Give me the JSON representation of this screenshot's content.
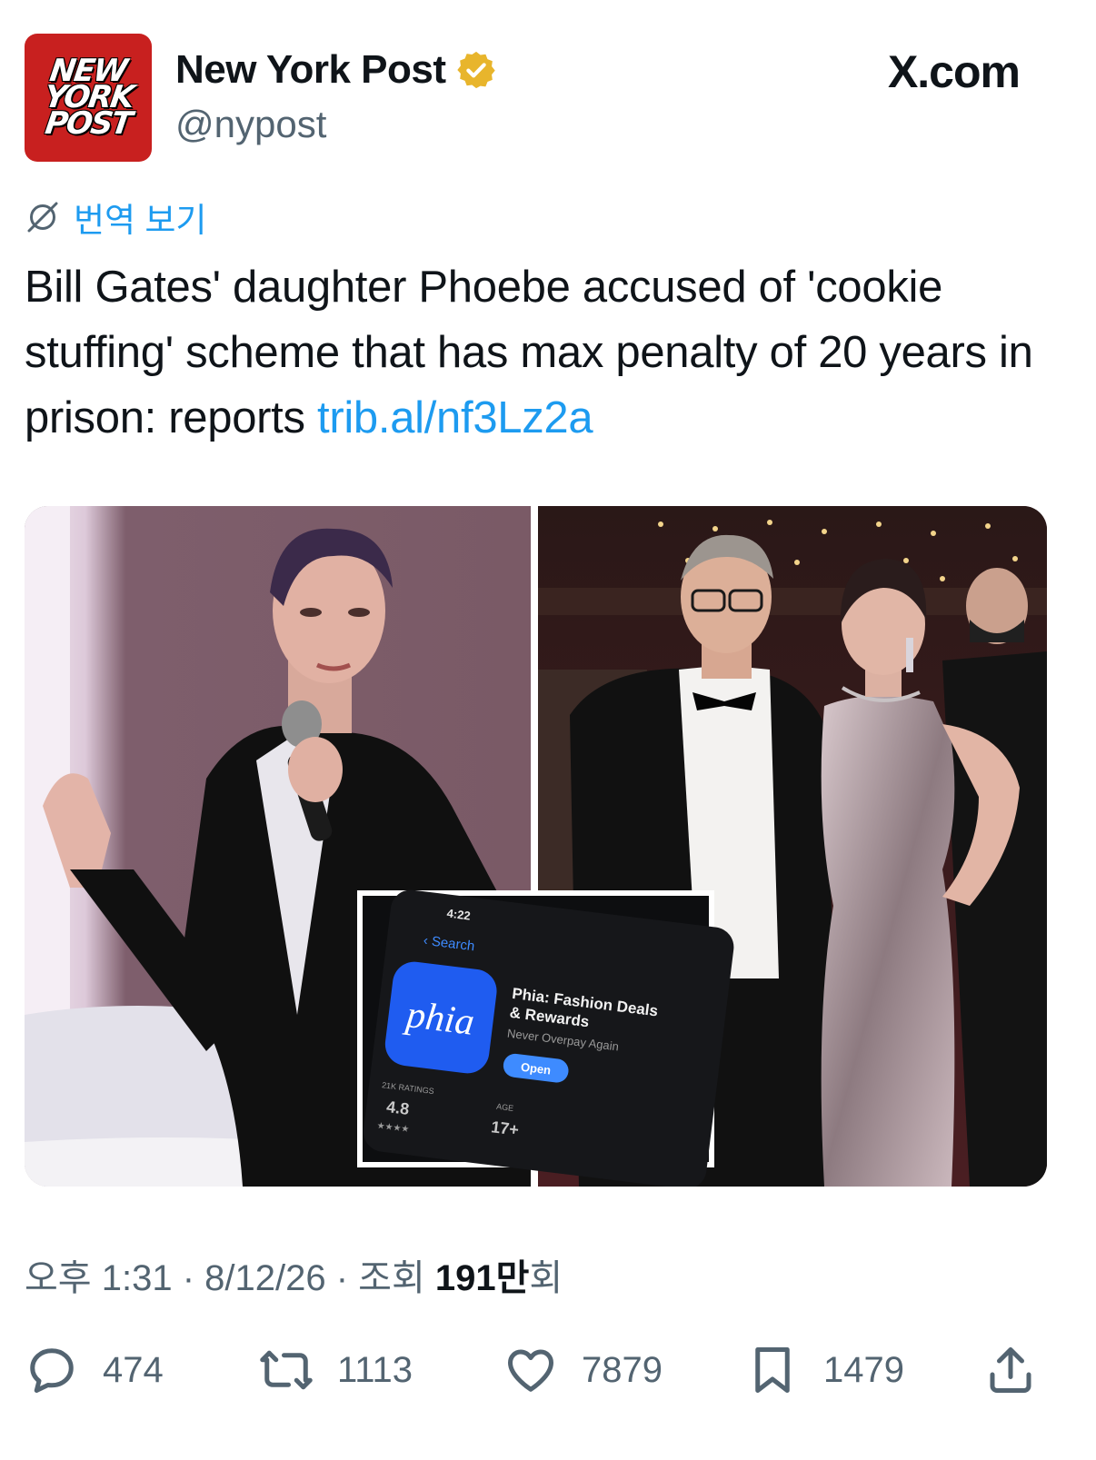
{
  "account": {
    "logo_lines": [
      "NEW",
      "YORK",
      "POST"
    ],
    "name": "New York Post",
    "handle": "@nypost",
    "verified": true,
    "verified_color": "#e8b52c"
  },
  "site_label": "X.com",
  "translate_label": "번역 보기",
  "tweet": {
    "text": "Bill Gates' daughter Phoebe accused of 'cookie stuffing' scheme that has max penalty of 20 years in prison: reports ",
    "link": "trib.al/nf3Lz2a"
  },
  "media": {
    "description_icon": "photo-collage",
    "inset": {
      "status_time": "4:22",
      "back_label": "Search",
      "app_icon_text": "phia",
      "app_title_line1": "Phia: Fashion Deals",
      "app_title_line2": "& Rewards",
      "app_subtitle": "Never Overpay Again",
      "open_button": "Open",
      "ratings_label": "21K RATINGS",
      "rating_value": "4.8",
      "age_label": "AGE",
      "age_value": "17+"
    }
  },
  "meta": {
    "time": "오후 1:31",
    "sep1": " · ",
    "date": "8/12/26",
    "sep2": " · ",
    "views_label": "조회 ",
    "views_value": "191만",
    "views_suffix": "회"
  },
  "actions": {
    "replies": "474",
    "reposts": "1113",
    "likes": "7879",
    "bookmarks": "1479"
  },
  "colors": {
    "link": "#1d9bf0",
    "secondary_text": "#536471",
    "brand_red": "#c8201f",
    "app_icon_blue": "#1f5cf0"
  }
}
